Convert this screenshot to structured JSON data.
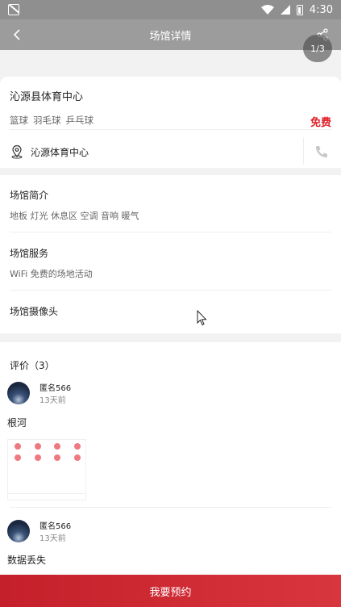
{
  "status_bar": {
    "time": "4:30"
  },
  "header": {
    "title": "场馆详情",
    "back_icon": "back-chevron-icon",
    "share_icon": "share-icon"
  },
  "gallery": {
    "pager": "1/3"
  },
  "venue": {
    "name": "沁源县体育中心",
    "tags": [
      "篮球",
      "羽毛球",
      "乒乓球"
    ],
    "price": "免费",
    "address": "沁源体育中心",
    "accent_color": "#e0202a"
  },
  "info": {
    "intro_title": "场馆简介",
    "intro_text": "地板 灯光 休息区 空调 音响 暖气",
    "service_title": "场馆服务",
    "service_text": "WiFi 免费的场地活动",
    "camera_title": "场馆摄像头"
  },
  "reviews": {
    "header": "评价（3）",
    "items": [
      {
        "user": "匿名566",
        "time": "13天前",
        "text": "根河"
      },
      {
        "user": "匿名566",
        "time": "13天前",
        "text": "数据丢失"
      }
    ]
  },
  "footer": {
    "book_label": "我要预约",
    "button_color": "#c41f2a"
  }
}
